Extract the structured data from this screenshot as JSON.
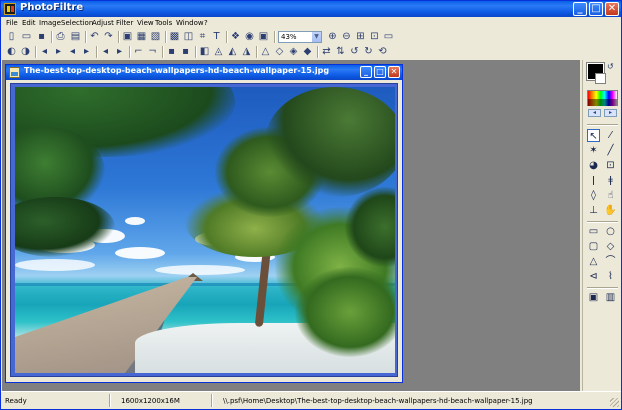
{
  "app": {
    "title": "PhotoFiltre",
    "window_controls": {
      "minimize": "_",
      "maximize": "□",
      "close": "✕"
    }
  },
  "menu": [
    "File",
    "Edit",
    "Image",
    "Selection",
    "Adjust",
    "Filter",
    "View",
    "Tools",
    "Window",
    "?"
  ],
  "toolbar": {
    "zoom_value": "43%"
  },
  "document": {
    "title": "The-best-top-desktop-beach-wallpapers-hd-beach-wallpaper-15.jpg",
    "window_controls": {
      "minimize": "_",
      "maximize": "□",
      "close": "✕"
    }
  },
  "statusbar": {
    "state": "Ready",
    "dimensions": "1600x1200x16M",
    "path": "\\\\.psf\\Home\\Desktop\\The-best-top-desktop-beach-wallpapers-hd-beach-wallpaper-15.jpg"
  },
  "icons": {
    "new": "new-file-icon",
    "open": "open-folder-icon",
    "save": "save-icon",
    "print": "print-icon",
    "scan": "scanner-icon",
    "undo": "undo-icon",
    "redo": "redo-icon",
    "zoom_in": "zoom-in-icon",
    "zoom_out": "zoom-out-icon"
  },
  "colors": {
    "foreground": "#000000",
    "background": "#ffffff",
    "titlebar_blue": "#0a5fe8",
    "workspace_gray": "#808080"
  }
}
